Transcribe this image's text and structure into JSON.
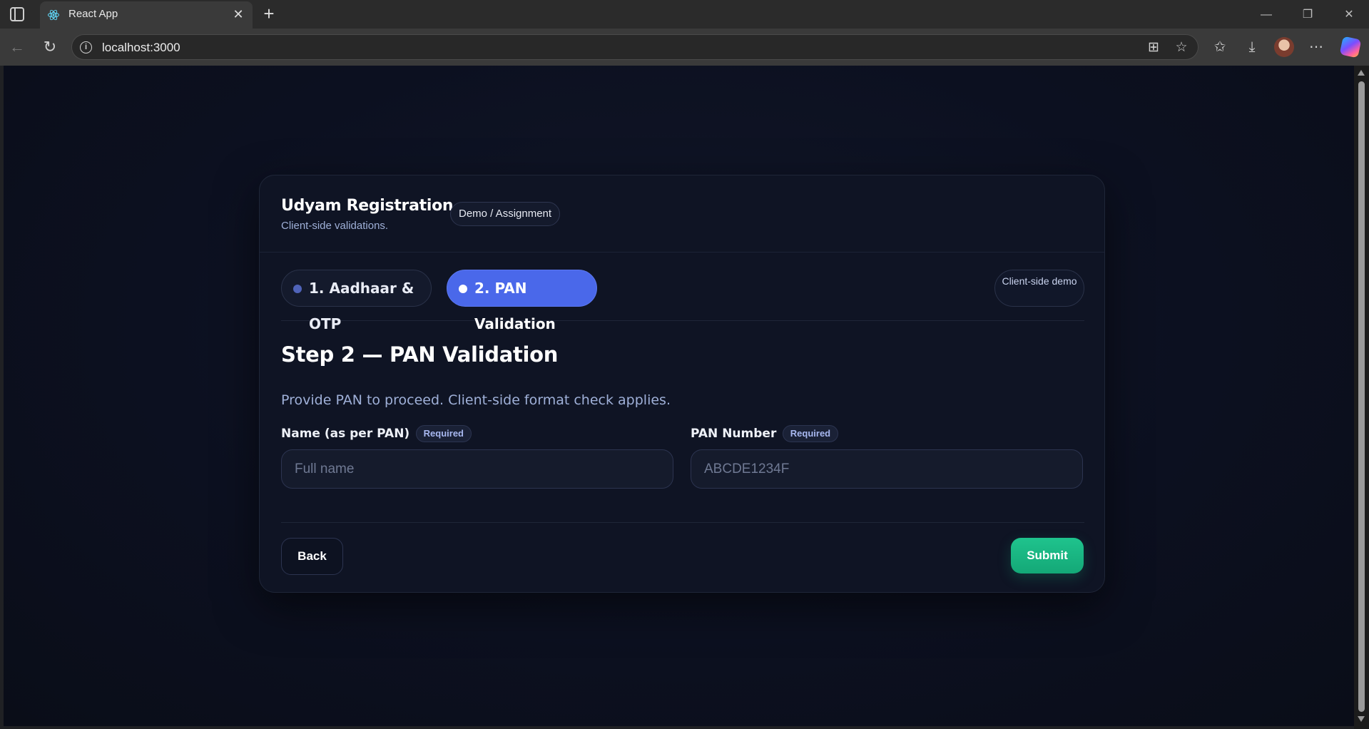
{
  "browser": {
    "tab_title": "React App",
    "tab_close_glyph": "✕",
    "new_tab_glyph": "+",
    "url": "localhost:3000",
    "window_controls": {
      "minimize": "—",
      "restore": "❐",
      "close": "✕"
    },
    "icons": [
      "sidebar-toggle-icon",
      "react-favicon-icon",
      "back-icon",
      "refresh-icon",
      "info-icon",
      "app-available-icon",
      "favorite-star-icon",
      "favorites-icon",
      "download-icon",
      "profile-avatar",
      "more-options-icon",
      "copilot-icon"
    ]
  },
  "header": {
    "title": "Udyam Registration",
    "subtitle": "Client-side validations.",
    "badge": "Demo / Assignment"
  },
  "steps": {
    "items": [
      {
        "label": "1. Aadhaar & OTP",
        "active": false
      },
      {
        "label": "2. PAN Validation",
        "active": true
      }
    ],
    "demo_pill": "Client-side demo"
  },
  "form": {
    "title": "Step 2 — PAN Validation",
    "description": "Provide PAN to proceed. Client-side format check applies.",
    "fields": [
      {
        "label": "Name (as per PAN)",
        "badge": "Required",
        "value": "",
        "placeholder": "Full name"
      },
      {
        "label": "PAN Number",
        "badge": "Required",
        "value": "",
        "placeholder": "ABCDE1234F"
      }
    ]
  },
  "actions": {
    "back_label": "Back",
    "submit_label": "Submit"
  },
  "colors": {
    "page_background": "#0c1020",
    "card_background": "#0f1424",
    "accent_blue": "#4a68ea",
    "submit_green": "#1fc38d",
    "muted_text": "#9fb0d8"
  }
}
